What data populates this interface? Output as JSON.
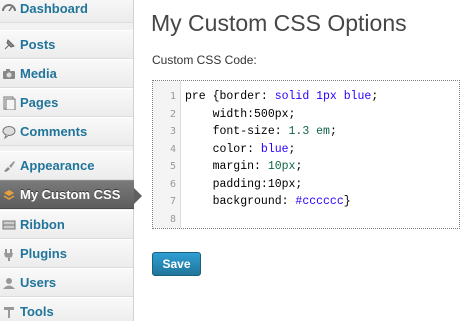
{
  "sidebar": {
    "items": [
      {
        "label": "Dashboard",
        "icon": "dashboard-icon"
      },
      {
        "label": "Posts",
        "icon": "posts-pin-icon"
      },
      {
        "label": "Media",
        "icon": "media-camera-icon"
      },
      {
        "label": "Pages",
        "icon": "pages-icon"
      },
      {
        "label": "Comments",
        "icon": "comments-bubble-icon"
      },
      {
        "label": "Appearance",
        "icon": "appearance-icon"
      },
      {
        "label": "My Custom CSS",
        "icon": "custom-css-icon"
      },
      {
        "label": "Ribbon",
        "icon": "ribbon-icon"
      },
      {
        "label": "Plugins",
        "icon": "plugins-plug-icon"
      },
      {
        "label": "Users",
        "icon": "users-icon"
      },
      {
        "label": "Tools",
        "icon": "tools-icon"
      }
    ],
    "current": "My Custom CSS",
    "accent_color": "#21759b"
  },
  "main": {
    "title": "My Custom CSS Options",
    "field_label": "Custom CSS Code:",
    "save_label": "Save"
  },
  "editor": {
    "line_numbers": [
      "1",
      "2",
      "3",
      "4",
      "5",
      "6",
      "7",
      "8"
    ],
    "lines": [
      {
        "prop": "pre {border: ",
        "val": "solid 1px blue",
        "end": ";"
      },
      {
        "prop": "    width:500px;",
        "val": "",
        "end": ""
      },
      {
        "prop": "    font-size: ",
        "val": "1.3 em",
        "end": ";"
      },
      {
        "prop": "    color: ",
        "val": "blue",
        "end": ";"
      },
      {
        "prop": "    margin: ",
        "val": "10px",
        "end": ";"
      },
      {
        "prop": "    padding:10px;",
        "val": "",
        "end": ""
      },
      {
        "prop": "    background: ",
        "val": "#cccccc",
        "end": "}"
      },
      {
        "prop": "",
        "val": "",
        "end": ""
      }
    ]
  }
}
